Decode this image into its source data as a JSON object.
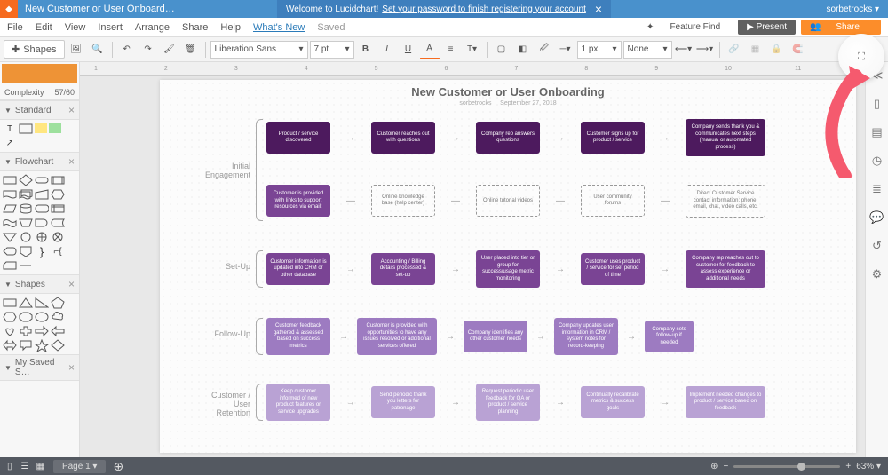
{
  "topbar": {
    "doc_title": "New Customer or User Onboard…",
    "notif_text": "Welcome to Lucidchart!",
    "notif_link": "Set your password to finish registering your account",
    "username": "sorbetrocks ▾"
  },
  "menu": {
    "file": "File",
    "edit": "Edit",
    "view": "View",
    "insert": "Insert",
    "arrange": "Arrange",
    "share": "Share",
    "help": "Help",
    "whatsnew": "What's New",
    "saved": "Saved",
    "feature_find": "Feature Find",
    "present": "▶ Present",
    "share_btn": "Share"
  },
  "toolbar": {
    "shapes": "Shapes",
    "font": "Liberation Sans",
    "fontsize": "7 pt",
    "linewidth": "1 px",
    "linestyle": "None"
  },
  "left": {
    "complexity": "Complexity",
    "complexity_val": "57/60",
    "standard": "Standard",
    "flowchart": "Flowchart",
    "shapes": "Shapes",
    "saved": "My Saved S…"
  },
  "doc": {
    "title": "New Customer or User Onboarding",
    "author": "sorbetrocks",
    "date": "September 27, 2018"
  },
  "rows": {
    "r1": {
      "label": "Initial\nEngagement",
      "boxes": [
        "Product / service discovered",
        "Customer reaches out with questions",
        "Company rep answers questions",
        "Customer signs up for product / service",
        "Company sends thank you & communicates next steps (manual or automated process)"
      ]
    },
    "r1b": {
      "boxes": [
        "Customer is provided with links to support resources via email:",
        "Online knowledge base (help center)",
        "Online tutorial videos",
        "User community forums",
        "Direct Customer Service contact information: phone, email, chat, video calls, etc."
      ]
    },
    "r2": {
      "label": "Set-Up",
      "boxes": [
        "Customer information is updated into CRM or other database",
        "Accounting / Billing details processed & set-up",
        "User placed into tier or group for success/usage metric monitoring",
        "Customer uses product / service for set period of time",
        "Company rep reaches out to customer for feedback to assess experience or additional needs"
      ]
    },
    "r3": {
      "label": "Follow-Up",
      "boxes": [
        "Customer feedback gathered & assessed based on success metrics",
        "Customer is provided with opportunities to have any issues resolved or additional services offered",
        "Company identifies any other customer needs",
        "Company updates user information in CRM / system notes for record-keeping",
        "Company sets follow-up if needed"
      ]
    },
    "r4": {
      "label": "Customer /\nUser Retention",
      "boxes": [
        "Keep customer informed of new product features or service upgrades",
        "Send periodic thank you letters for patronage",
        "Request periodic user feedback for QA or product / service planning",
        "Continually recalibrate metrics & success goals",
        "Implement needed changes to product / service based on feedback"
      ]
    }
  },
  "bottom": {
    "page": "Page 1 ▾",
    "zoom": "63% ▾"
  }
}
